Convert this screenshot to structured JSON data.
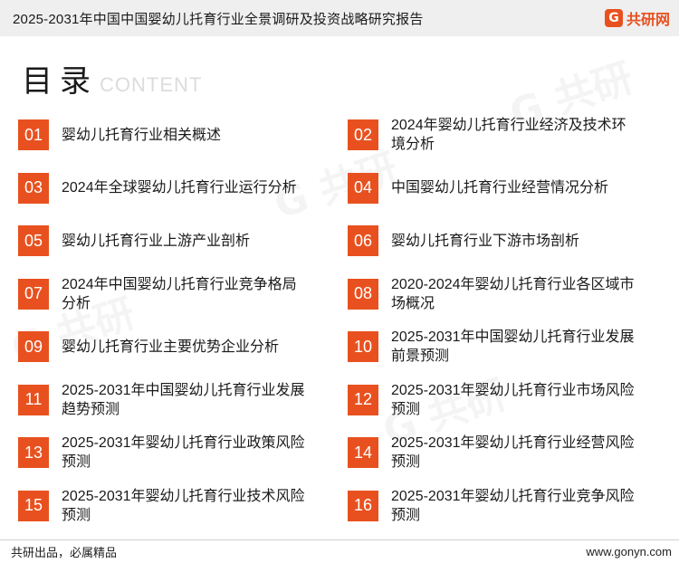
{
  "header": {
    "title": "2025-2031年中国中国婴幼儿托育行业全景调研及投资战略研究报告",
    "logo": {
      "icon": "g-logo-icon",
      "text": "共研网",
      "color": "#e8511f"
    }
  },
  "toc": {
    "heading": "目录",
    "heading_sub": "CONTENT",
    "accent_color": "#e8511f",
    "items": [
      {
        "num": "01",
        "label": "婴幼儿托育行业相关概述"
      },
      {
        "num": "02",
        "label": "2024年婴幼儿托育行业经济及技术环境分析"
      },
      {
        "num": "03",
        "label": "2024年全球婴幼儿托育行业运行分析"
      },
      {
        "num": "04",
        "label": "中国婴幼儿托育行业经营情况分析"
      },
      {
        "num": "05",
        "label": "婴幼儿托育行业上游产业剖析"
      },
      {
        "num": "06",
        "label": "婴幼儿托育行业下游市场剖析"
      },
      {
        "num": "07",
        "label": "2024年中国婴幼儿托育行业竞争格局分析"
      },
      {
        "num": "08",
        "label": "2020-2024年婴幼儿托育行业各区域市场概况"
      },
      {
        "num": "09",
        "label": "婴幼儿托育行业主要优势企业分析"
      },
      {
        "num": "10",
        "label": "2025-2031年中国婴幼儿托育行业发展前景预测"
      },
      {
        "num": "11",
        "label": "2025-2031年中国婴幼儿托育行业发展趋势预测"
      },
      {
        "num": "12",
        "label": "2025-2031年婴幼儿托育行业市场风险预测"
      },
      {
        "num": "13",
        "label": "2025-2031年婴幼儿托育行业政策风险预测"
      },
      {
        "num": "14",
        "label": "2025-2031年婴幼儿托育行业经营风险预测"
      },
      {
        "num": "15",
        "label": "2025-2031年婴幼儿托育行业技术风险预测"
      },
      {
        "num": "16",
        "label": "2025-2031年婴幼儿托育行业竞争风险预测"
      }
    ]
  },
  "footer": {
    "slogan": "共研出品，必属精品",
    "url": "www.gonyn.com"
  }
}
